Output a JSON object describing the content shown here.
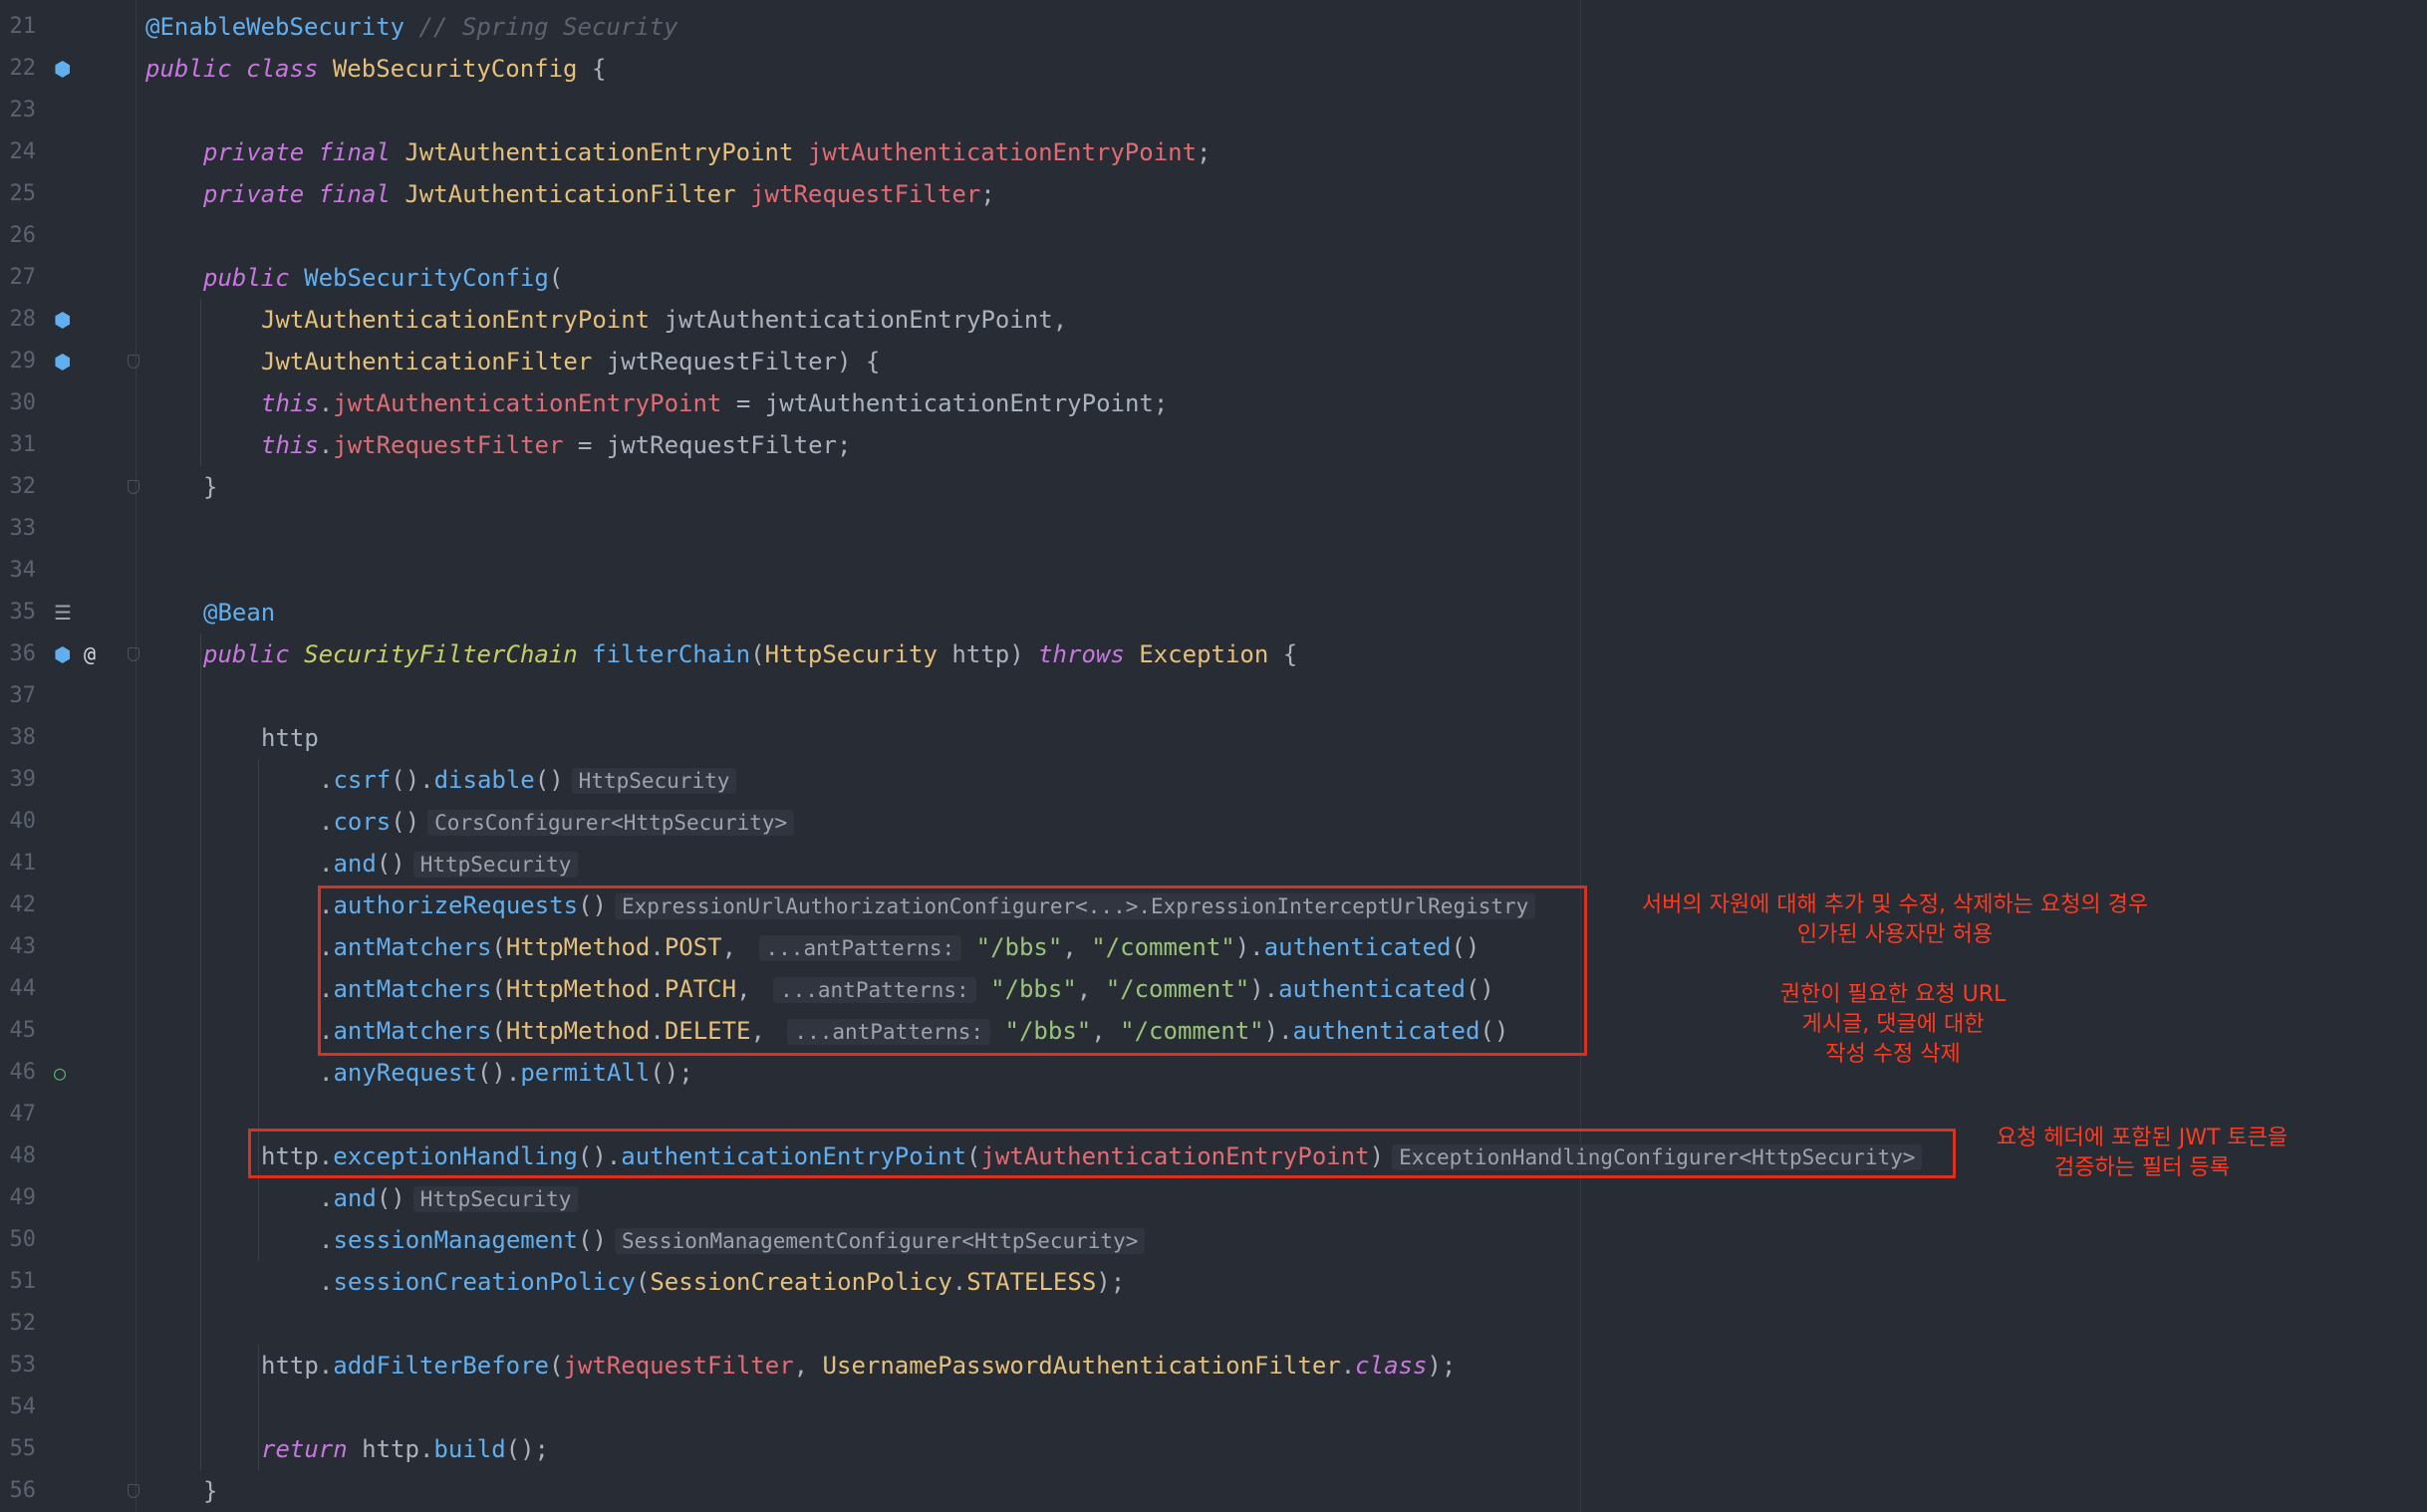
{
  "editor": {
    "lines": [
      {
        "n": "21",
        "icons": [],
        "indent": 0,
        "segs": [
          [
            "an",
            "@EnableWebSecurity"
          ],
          [
            "pl",
            " "
          ],
          [
            "cm",
            "// Spring Security"
          ]
        ]
      },
      {
        "n": "22",
        "icons": [
          "cube-search"
        ],
        "indent": 0,
        "segs": [
          [
            "k",
            "public"
          ],
          [
            "pl",
            " "
          ],
          [
            "k",
            "class"
          ],
          [
            "pl",
            " "
          ],
          [
            "t",
            "WebSecurityConfig"
          ],
          [
            "pl",
            " {"
          ]
        ]
      },
      {
        "n": "23",
        "icons": [],
        "indent": 0,
        "segs": []
      },
      {
        "n": "24",
        "icons": [],
        "indent": 1,
        "segs": [
          [
            "k",
            "private"
          ],
          [
            "pl",
            " "
          ],
          [
            "k",
            "final"
          ],
          [
            "pl",
            " "
          ],
          [
            "t",
            "JwtAuthenticationEntryPoint"
          ],
          [
            "pl",
            " "
          ],
          [
            "fi",
            "jwtAuthenticationEntryPoint"
          ],
          [
            "pl",
            ";"
          ]
        ]
      },
      {
        "n": "25",
        "icons": [],
        "indent": 1,
        "segs": [
          [
            "k",
            "private"
          ],
          [
            "pl",
            " "
          ],
          [
            "k",
            "final"
          ],
          [
            "pl",
            " "
          ],
          [
            "t",
            "JwtAuthenticationFilter"
          ],
          [
            "pl",
            " "
          ],
          [
            "fi",
            "jwtRequestFilter"
          ],
          [
            "pl",
            ";"
          ]
        ]
      },
      {
        "n": "26",
        "icons": [],
        "indent": 0,
        "segs": []
      },
      {
        "n": "27",
        "icons": [],
        "indent": 1,
        "segs": [
          [
            "k",
            "public"
          ],
          [
            "pl",
            " "
          ],
          [
            "f",
            "WebSecurityConfig"
          ],
          [
            "pl",
            "("
          ]
        ]
      },
      {
        "n": "28",
        "icons": [
          "cube"
        ],
        "indent": 2,
        "segs": [
          [
            "t",
            "JwtAuthenticationEntryPoint"
          ],
          [
            "pl",
            " jwtAuthenticationEntryPoint,"
          ]
        ]
      },
      {
        "n": "29",
        "icons": [
          "cube"
        ],
        "indent": 2,
        "segs": [
          [
            "t",
            "JwtAuthenticationFilter"
          ],
          [
            "pl",
            " jwtRequestFilter) {"
          ]
        ]
      },
      {
        "n": "30",
        "icons": [],
        "indent": 2,
        "segs": [
          [
            "k",
            "this"
          ],
          [
            "pl",
            "."
          ],
          [
            "fi",
            "jwtAuthenticationEntryPoint"
          ],
          [
            "pl",
            " = jwtAuthenticationEntryPoint;"
          ]
        ]
      },
      {
        "n": "31",
        "icons": [],
        "indent": 2,
        "segs": [
          [
            "k",
            "this"
          ],
          [
            "pl",
            "."
          ],
          [
            "fi",
            "jwtRequestFilter"
          ],
          [
            "pl",
            " = jwtRequestFilter;"
          ]
        ]
      },
      {
        "n": "32",
        "icons": [],
        "indent": 1,
        "segs": [
          [
            "pl",
            "}"
          ]
        ]
      },
      {
        "n": "33",
        "icons": [],
        "indent": 0,
        "segs": []
      },
      {
        "n": "34",
        "icons": [],
        "indent": 0,
        "segs": []
      },
      {
        "n": "35",
        "icons": [
          "list"
        ],
        "indent": 1,
        "segs": [
          [
            "an",
            "@Bean"
          ]
        ]
      },
      {
        "n": "36",
        "icons": [
          "cube",
          "at"
        ],
        "indent": 1,
        "segs": [
          [
            "k",
            "public"
          ],
          [
            "pl",
            " "
          ],
          [
            "ti",
            "SecurityFilterChain"
          ],
          [
            "pl",
            " "
          ],
          [
            "f",
            "filterChain"
          ],
          [
            "pl",
            "("
          ],
          [
            "t",
            "HttpSecurity"
          ],
          [
            "pl",
            " http) "
          ],
          [
            "k",
            "throws"
          ],
          [
            "pl",
            " "
          ],
          [
            "t",
            "Exception"
          ],
          [
            "pl",
            " {"
          ]
        ]
      },
      {
        "n": "37",
        "icons": [],
        "indent": 0,
        "segs": []
      },
      {
        "n": "38",
        "icons": [],
        "indent": 2,
        "segs": [
          [
            "pl",
            "http"
          ]
        ]
      },
      {
        "n": "39",
        "icons": [],
        "indent": 3,
        "segs": [
          [
            "pl",
            "."
          ],
          [
            "f",
            "csrf"
          ],
          [
            "pl",
            "()."
          ],
          [
            "f",
            "disable"
          ],
          [
            "pl",
            "()"
          ],
          [
            "hint",
            "HttpSecurity"
          ]
        ]
      },
      {
        "n": "40",
        "icons": [],
        "indent": 3,
        "segs": [
          [
            "pl",
            "."
          ],
          [
            "f",
            "cors"
          ],
          [
            "pl",
            "()"
          ],
          [
            "hint",
            "CorsConfigurer<HttpSecurity>"
          ]
        ]
      },
      {
        "n": "41",
        "icons": [],
        "indent": 3,
        "segs": [
          [
            "pl",
            "."
          ],
          [
            "f",
            "and"
          ],
          [
            "pl",
            "()"
          ],
          [
            "hint",
            "HttpSecurity"
          ]
        ]
      },
      {
        "n": "42",
        "icons": [],
        "indent": 3,
        "segs": [
          [
            "pl",
            "."
          ],
          [
            "f",
            "authorizeRequests"
          ],
          [
            "pl",
            "()"
          ],
          [
            "hint",
            "ExpressionUrlAuthorizationConfigurer<...>.ExpressionInterceptUrlRegistry"
          ]
        ]
      },
      {
        "n": "43",
        "icons": [],
        "indent": 3,
        "segs": [
          [
            "pl",
            "."
          ],
          [
            "f",
            "antMatchers"
          ],
          [
            "pl",
            "("
          ],
          [
            "t",
            "HttpMethod"
          ],
          [
            "pl",
            "."
          ],
          [
            "ec",
            "POST"
          ],
          [
            "pl",
            ", "
          ],
          [
            "hint",
            "...antPatterns:"
          ],
          [
            "pl",
            " "
          ],
          [
            "s",
            "\"/bbs\""
          ],
          [
            "pl",
            ", "
          ],
          [
            "s",
            "\"/comment\""
          ],
          [
            "pl",
            ")."
          ],
          [
            "f",
            "authenticated"
          ],
          [
            "pl",
            "()"
          ]
        ]
      },
      {
        "n": "44",
        "icons": [],
        "indent": 3,
        "segs": [
          [
            "pl",
            "."
          ],
          [
            "f",
            "antMatchers"
          ],
          [
            "pl",
            "("
          ],
          [
            "t",
            "HttpMethod"
          ],
          [
            "pl",
            "."
          ],
          [
            "ec",
            "PATCH"
          ],
          [
            "pl",
            ", "
          ],
          [
            "hint",
            "...antPatterns:"
          ],
          [
            "pl",
            " "
          ],
          [
            "s",
            "\"/bbs\""
          ],
          [
            "pl",
            ", "
          ],
          [
            "s",
            "\"/comment\""
          ],
          [
            "pl",
            ")."
          ],
          [
            "f",
            "authenticated"
          ],
          [
            "pl",
            "()"
          ]
        ]
      },
      {
        "n": "45",
        "icons": [],
        "indent": 3,
        "segs": [
          [
            "pl",
            "."
          ],
          [
            "f",
            "antMatchers"
          ],
          [
            "pl",
            "("
          ],
          [
            "t",
            "HttpMethod"
          ],
          [
            "pl",
            "."
          ],
          [
            "ec",
            "DELETE"
          ],
          [
            "pl",
            ", "
          ],
          [
            "hint",
            "...antPatterns:"
          ],
          [
            "pl",
            " "
          ],
          [
            "s",
            "\"/bbs\""
          ],
          [
            "pl",
            ", "
          ],
          [
            "s",
            "\"/comment\""
          ],
          [
            "pl",
            ")."
          ],
          [
            "f",
            "authenticated"
          ],
          [
            "pl",
            "()"
          ]
        ]
      },
      {
        "n": "46",
        "icons": [
          "circle"
        ],
        "indent": 3,
        "segs": [
          [
            "pl",
            "."
          ],
          [
            "f",
            "anyRequest"
          ],
          [
            "pl",
            "()."
          ],
          [
            "f",
            "permitAll"
          ],
          [
            "pl",
            "();"
          ]
        ]
      },
      {
        "n": "47",
        "icons": [],
        "indent": 0,
        "segs": []
      },
      {
        "n": "48",
        "icons": [],
        "indent": 2,
        "segs": [
          [
            "pl",
            "http."
          ],
          [
            "f",
            "exceptionHandling"
          ],
          [
            "pl",
            "()."
          ],
          [
            "f",
            "authenticationEntryPoint"
          ],
          [
            "pl",
            "("
          ],
          [
            "fi",
            "jwtAuthenticationEntryPoint"
          ],
          [
            "pl",
            ")"
          ],
          [
            "hint",
            "ExceptionHandlingConfigurer<HttpSecurity>"
          ]
        ]
      },
      {
        "n": "49",
        "icons": [],
        "indent": 3,
        "segs": [
          [
            "pl",
            "."
          ],
          [
            "f",
            "and"
          ],
          [
            "pl",
            "()"
          ],
          [
            "hint",
            "HttpSecurity"
          ]
        ]
      },
      {
        "n": "50",
        "icons": [],
        "indent": 3,
        "segs": [
          [
            "pl",
            "."
          ],
          [
            "f",
            "sessionManagement"
          ],
          [
            "pl",
            "()"
          ],
          [
            "hint",
            "SessionManagementConfigurer<HttpSecurity>"
          ]
        ]
      },
      {
        "n": "51",
        "icons": [],
        "indent": 3,
        "segs": [
          [
            "pl",
            "."
          ],
          [
            "f",
            "sessionCreationPolicy"
          ],
          [
            "pl",
            "("
          ],
          [
            "t",
            "SessionCreationPolicy"
          ],
          [
            "pl",
            "."
          ],
          [
            "ec",
            "STATELESS"
          ],
          [
            "pl",
            ");"
          ]
        ]
      },
      {
        "n": "52",
        "icons": [],
        "indent": 0,
        "segs": []
      },
      {
        "n": "53",
        "icons": [],
        "indent": 2,
        "segs": [
          [
            "pl",
            "http."
          ],
          [
            "f",
            "addFilterBefore"
          ],
          [
            "pl",
            "("
          ],
          [
            "fi",
            "jwtRequestFilter"
          ],
          [
            "pl",
            ", "
          ],
          [
            "t",
            "UsernamePasswordAuthenticationFilter"
          ],
          [
            "pl",
            "."
          ],
          [
            "k",
            "class"
          ],
          [
            "pl",
            ");"
          ]
        ]
      },
      {
        "n": "54",
        "icons": [],
        "indent": 0,
        "segs": []
      },
      {
        "n": "55",
        "icons": [],
        "indent": 2,
        "segs": [
          [
            "k",
            "return"
          ],
          [
            "pl",
            " http."
          ],
          [
            "f",
            "build"
          ],
          [
            "pl",
            "();"
          ]
        ]
      },
      {
        "n": "56",
        "icons": [],
        "indent": 1,
        "segs": [
          [
            "pl",
            "}"
          ]
        ]
      }
    ]
  },
  "annotations": {
    "auth_note_line1": "서버의 자원에 대해 추가 및 수정, 삭제하는 요청의 경우",
    "auth_note_line2": "인가된 사용자만 허용",
    "url_note_line1": "권한이 필요한 요청 URL",
    "url_note_line2": "게시글, 댓글에 대한",
    "url_note_line3": "작성 수정 삭제",
    "jwt_note_line1": "요청 헤더에 포함된 JWT 토큰을",
    "jwt_note_line2": "검증하는 필터 등록"
  },
  "colors": {
    "background": "#282c34",
    "keyword": "#c678dd",
    "type": "#e5c07b",
    "function": "#61afef",
    "field": "#e06c75",
    "string": "#98c379",
    "highlight_box": "#d6321f",
    "annotation_text": "#ff3b1f"
  }
}
